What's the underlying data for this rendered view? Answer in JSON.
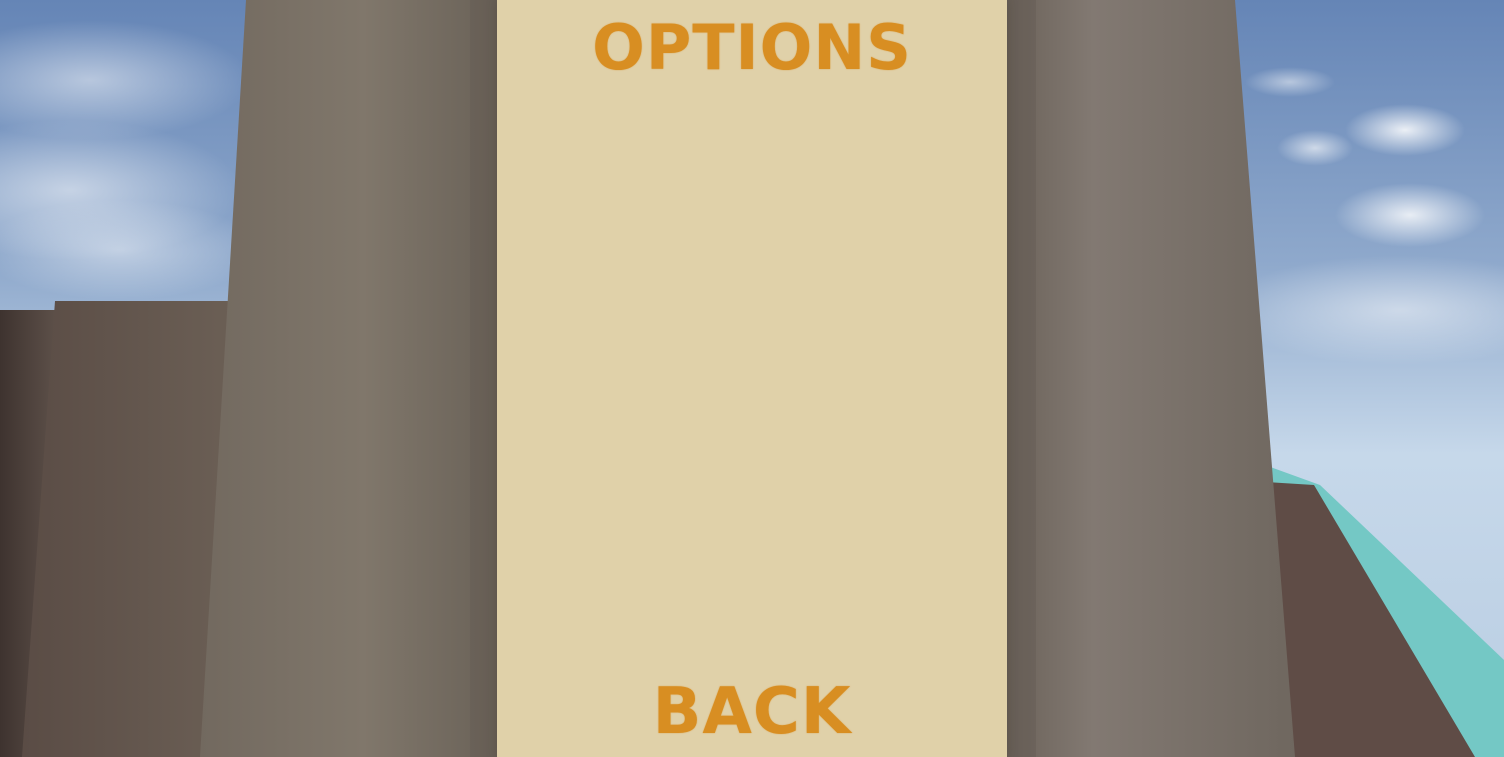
{
  "menu": {
    "title": "OPTIONS",
    "back_label": "BACK"
  },
  "colors": {
    "panel": "#e0d1a9",
    "text_accent": "#d88e22",
    "sky_top": "#6585b6",
    "sky_horizon": "#c5d8ea",
    "tower_stone": "#7c7369",
    "rock_brown": "#5e4c45",
    "ground_teal": "#74c8c5"
  }
}
